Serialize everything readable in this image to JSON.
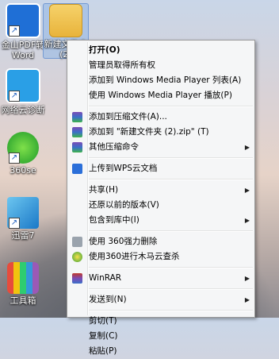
{
  "desktop": {
    "icons": [
      {
        "label": "金山PDF转\nWord"
      },
      {
        "label": "新建文件夹\n(2)"
      },
      {
        "label": "网络云诊断"
      },
      {
        "label": "360se"
      },
      {
        "label": "迅雷7"
      },
      {
        "label": "工具箱"
      }
    ]
  },
  "context_menu": {
    "items": [
      {
        "label": "打开(O)"
      },
      {
        "label": "管理员取得所有权"
      },
      {
        "label": "添加到 Windows Media Player 列表(A)"
      },
      {
        "label": "使用 Windows Media Player 播放(P)"
      },
      {
        "label": "添加到压缩文件(A)..."
      },
      {
        "label": "添加到 \"新建文件夹 (2).zip\" (T)"
      },
      {
        "label": "其他压缩命令"
      },
      {
        "label": "上传到WPS云文档"
      },
      {
        "label": "共享(H)"
      },
      {
        "label": "还原以前的版本(V)"
      },
      {
        "label": "包含到库中(I)"
      },
      {
        "label": "使用 360强力删除"
      },
      {
        "label": "使用360进行木马云查杀"
      },
      {
        "label": "WinRAR"
      },
      {
        "label": "发送到(N)"
      },
      {
        "label": "剪切(T)"
      },
      {
        "label": "复制(C)"
      },
      {
        "label": "粘贴(P)"
      }
    ],
    "submenu_arrow": "▶"
  },
  "colors": {
    "menu_bg": "#f5f6f7",
    "folder": "#e8b33b"
  }
}
